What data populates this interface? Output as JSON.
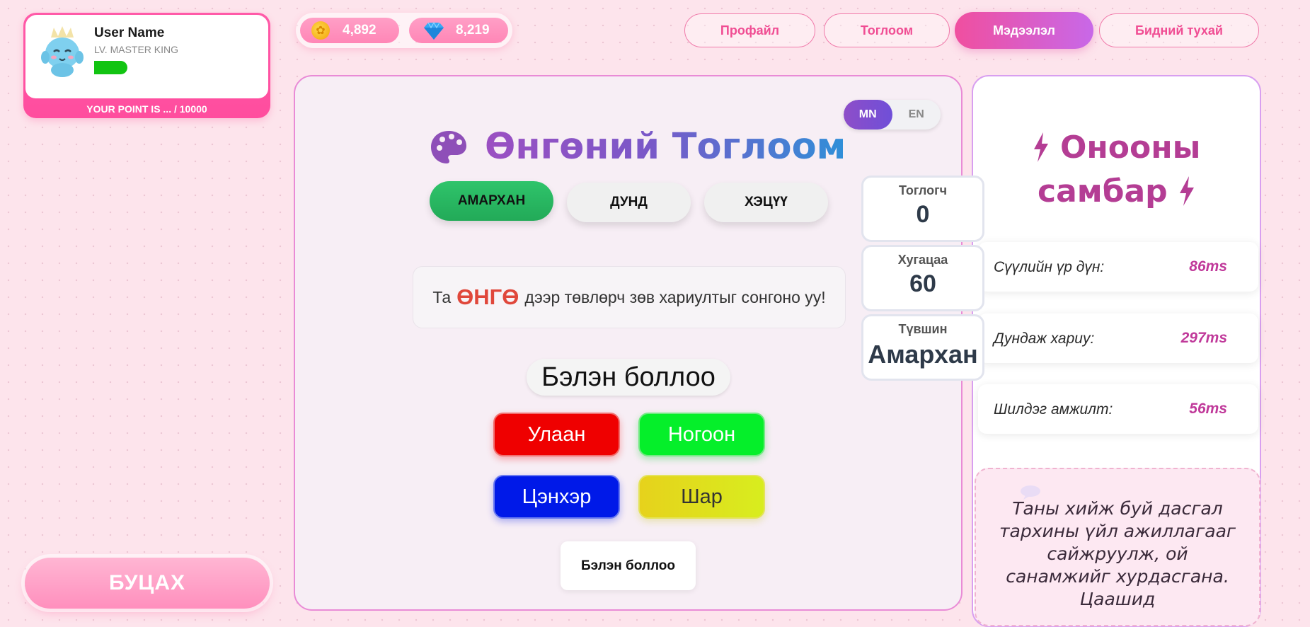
{
  "user": {
    "name": "User Name",
    "level": "LV. MASTER KING",
    "points_text": "YOUR POINT IS ... / 10000",
    "progress_fraction": 0.5
  },
  "currency": {
    "coins": "4,892",
    "gems": "8,219",
    "coin_icon": "coin-icon",
    "gem_icon": "diamond-icon"
  },
  "nav": {
    "tabs": [
      {
        "label": "Профайл",
        "active": false
      },
      {
        "label": "Тоглоом",
        "active": false
      },
      {
        "label": "Мэдээлэл",
        "active": true
      },
      {
        "label": "Бидний тухай",
        "active": false
      }
    ]
  },
  "game": {
    "title": "Өнгөний Тоглоом",
    "title_icon": "palette-icon",
    "lang_options": [
      "MN",
      "EN"
    ],
    "lang_selected": "MN",
    "difficulty": [
      "АМАРХАН",
      "ДУНД",
      "ХЭЦҮҮ"
    ],
    "difficulty_selected": "АМАРХАН",
    "instruction_prefix": "Та",
    "instruction_highlight": "ӨНГӨ",
    "instruction_suffix": "дээр төвлөрч зөв хариултыг сонгоно уу!",
    "status": "Бэлэн боллоо",
    "color_buttons": [
      "Улаан",
      "Ногоон",
      "Цэнхэр",
      "Шар"
    ],
    "ready_button": "Бэлэн боллоо"
  },
  "stats": {
    "player_label": "Тоглогч",
    "player_value": "0",
    "time_label": "Хугацаа",
    "time_value": "60",
    "level_label": "Түвшин",
    "level_value": "Амархан"
  },
  "scoreboard": {
    "title_line1": "Онооны",
    "title_line2": "самбар",
    "rows": [
      {
        "label": "Сүүлийн үр дүн:",
        "value": "86ms"
      },
      {
        "label": "Дундаж хариу:",
        "value": "297ms"
      },
      {
        "label": "Шилдэг амжилт:",
        "value": "56ms"
      }
    ],
    "tip": "Таны хийж буй дасгал тархины үйл ажиллагааг сайжруулж, ой санамжийг хурдасгана. Цаашид"
  },
  "back_button": "БУЦАХ",
  "colors": {
    "accent_pink": "#ff4d9e",
    "active_nav": "#f04f9f",
    "easy_green": "#2fc46b",
    "score_purple": "#b43d94"
  }
}
